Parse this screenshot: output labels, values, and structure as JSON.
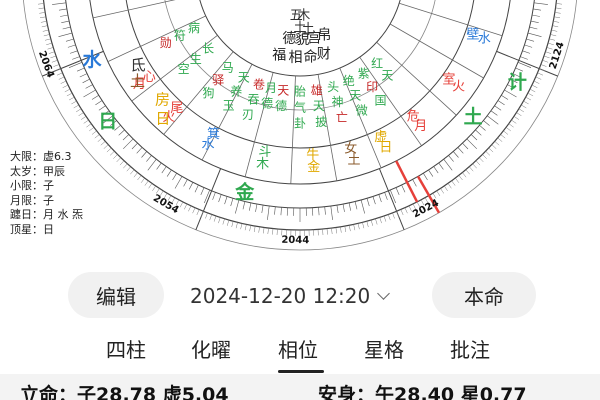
{
  "chart": {
    "years": [
      "2064",
      "2054",
      "2044",
      "2024",
      "2124"
    ],
    "elements": [
      "水",
      "土",
      "计",
      "日",
      "金"
    ],
    "lodges": [
      {
        "planet": "月",
        "name": "心",
        "color": "#e6403a"
      },
      {
        "planet": "火",
        "name": "尾",
        "color": "#e6403a"
      },
      {
        "planet": "水",
        "name": "箕",
        "color": "#2979d8"
      },
      {
        "planet": "木",
        "name": "斗",
        "color": "#2fa84f"
      },
      {
        "planet": "金",
        "name": "牛",
        "color": "#e0a800"
      },
      {
        "planet": "土",
        "name": "女",
        "color": "#8a5a2b"
      },
      {
        "planet": "日",
        "name": "虚",
        "color": "#e0a800"
      },
      {
        "planet": "月",
        "name": "危",
        "color": "#e6403a"
      },
      {
        "planet": "火",
        "name": "室",
        "color": "#e6403a"
      },
      {
        "planet": "水",
        "name": "壁",
        "color": "#2979d8"
      }
    ],
    "outer_labels": [
      {
        "text": "氐",
        "color": "#333333"
      },
      {
        "text": "土",
        "color": "#8a5a2b"
      },
      {
        "text": "房",
        "color": "#e0a800"
      },
      {
        "text": "日",
        "color": "#e0a800"
      }
    ],
    "houses": [
      "福",
      "德",
      "相",
      "貌",
      "命",
      "宫",
      "财",
      "帛"
    ],
    "stars_green": [
      "病",
      "符",
      "勋",
      "长",
      "生",
      "空",
      "马",
      "驿",
      "狗",
      "天",
      "养",
      "玉",
      "卷",
      "吞",
      "刃",
      "月",
      "德",
      "天",
      "德",
      "胎",
      "气",
      "卦",
      "雄",
      "天",
      "披",
      "头",
      "神",
      "亡",
      "绝",
      "天",
      "微",
      "紫",
      "印",
      "国",
      "红",
      "天"
    ],
    "stars_top": [
      "五",
      "土",
      "木",
      "土"
    ]
  },
  "info_panel": {
    "rows": [
      "大限：虚6.3",
      "太岁：甲辰",
      "小限：子",
      "月限：子",
      "躔日：月 水 炁",
      "顶星：日"
    ]
  },
  "toolbar": {
    "edit_label": "编辑",
    "datetime": "2024-12-20 12:20",
    "main_label": "本命"
  },
  "tabs": [
    {
      "label": "四柱"
    },
    {
      "label": "化曜"
    },
    {
      "label": "相位"
    },
    {
      "label": "星格"
    },
    {
      "label": "批注"
    }
  ],
  "active_tab": "相位",
  "bottom": {
    "left": "立命：子28.78 虚5.04",
    "right": "安身：午28.40 星0.77"
  },
  "colors": {
    "red": "#e6403a",
    "blue": "#2979d8",
    "green": "#2fa84f",
    "gold": "#e0a800",
    "brown": "#8a5a2b",
    "pill_bg": "#f1f1f1"
  }
}
